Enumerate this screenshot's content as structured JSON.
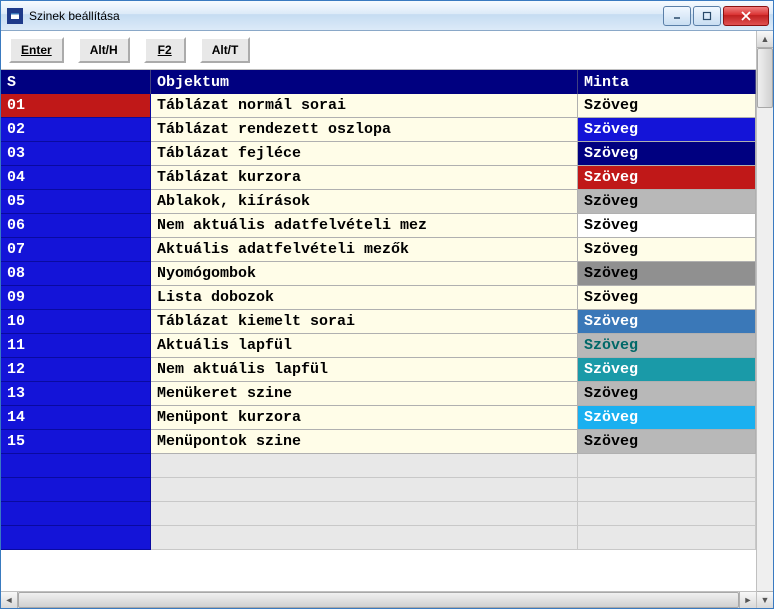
{
  "window": {
    "title": "Szinek beállítása"
  },
  "toolbar": {
    "buttons": [
      {
        "label": "Enter",
        "underline": true
      },
      {
        "label": "Alt/H",
        "underline": false
      },
      {
        "label": "F2",
        "underline": true
      },
      {
        "label": "Alt/T",
        "underline": false
      }
    ]
  },
  "table": {
    "headers": {
      "s": "S",
      "obj": "Objektum",
      "sample": "Minta"
    },
    "sample_default_text": "Szöveg",
    "rows": [
      {
        "s": "01",
        "obj": "Táblázat normál sorai",
        "s_bg": "#c01818",
        "s_fg": "#ffffff",
        "sample_bg": "#fffde8",
        "sample_fg": "#000000"
      },
      {
        "s": "02",
        "obj": "Táblázat rendezett oszlopa",
        "s_bg": "#1414d8",
        "s_fg": "#ffffff",
        "sample_bg": "#1414d8",
        "sample_fg": "#ffffff"
      },
      {
        "s": "03",
        "obj": "Táblázat fejléce",
        "s_bg": "#1414d8",
        "s_fg": "#ffffff",
        "sample_bg": "#000080",
        "sample_fg": "#ffffff"
      },
      {
        "s": "04",
        "obj": "Táblázat kurzora",
        "s_bg": "#1414d8",
        "s_fg": "#ffffff",
        "sample_bg": "#c01818",
        "sample_fg": "#ffffff"
      },
      {
        "s": "05",
        "obj": "Ablakok, kiírások",
        "s_bg": "#1414d8",
        "s_fg": "#ffffff",
        "sample_bg": "#b8b8b8",
        "sample_fg": "#000000"
      },
      {
        "s": "06",
        "obj": "Nem aktuális adatfelvételi mez",
        "s_bg": "#1414d8",
        "s_fg": "#ffffff",
        "sample_bg": "#ffffff",
        "sample_fg": "#000000"
      },
      {
        "s": "07",
        "obj": "Aktuális adatfelvételi mezők",
        "s_bg": "#1414d8",
        "s_fg": "#ffffff",
        "sample_bg": "#fffde8",
        "sample_fg": "#000000"
      },
      {
        "s": "08",
        "obj": "Nyomógombok",
        "s_bg": "#1414d8",
        "s_fg": "#ffffff",
        "sample_bg": "#909090",
        "sample_fg": "#000000"
      },
      {
        "s": "09",
        "obj": "Lista dobozok",
        "s_bg": "#1414d8",
        "s_fg": "#ffffff",
        "sample_bg": "#fffde8",
        "sample_fg": "#000000"
      },
      {
        "s": "10",
        "obj": "Táblázat kiemelt sorai",
        "s_bg": "#1414d8",
        "s_fg": "#ffffff",
        "sample_bg": "#3a78b8",
        "sample_fg": "#ffffff"
      },
      {
        "s": "11",
        "obj": "Aktuális lapfül",
        "s_bg": "#1414d8",
        "s_fg": "#ffffff",
        "sample_bg": "#b8b8b8",
        "sample_fg": "#006868"
      },
      {
        "s": "12",
        "obj": "Nem aktuális lapfül",
        "s_bg": "#1414d8",
        "s_fg": "#ffffff",
        "sample_bg": "#1a9aa8",
        "sample_fg": "#ffffff"
      },
      {
        "s": "13",
        "obj": "Menükeret szine",
        "s_bg": "#1414d8",
        "s_fg": "#ffffff",
        "sample_bg": "#b8b8b8",
        "sample_fg": "#000000"
      },
      {
        "s": "14",
        "obj": "Menüpont kurzora",
        "s_bg": "#1414d8",
        "s_fg": "#ffffff",
        "sample_bg": "#1ab0f0",
        "sample_fg": "#ffffff"
      },
      {
        "s": "15",
        "obj": "Menüpontok szine",
        "s_bg": "#1414d8",
        "s_fg": "#ffffff",
        "sample_bg": "#b8b8b8",
        "sample_fg": "#000000"
      }
    ],
    "empty_rows": 4
  }
}
